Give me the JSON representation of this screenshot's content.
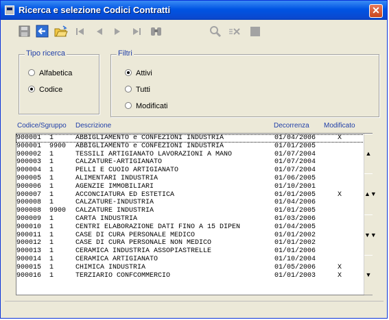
{
  "window": {
    "title": "Ricerca e selezione Codici Contratti",
    "close_label": "✕"
  },
  "toolbar": {
    "icons": [
      "save-icon",
      "back-icon",
      "open-folder-icon",
      "first-record-icon",
      "previous-record-icon",
      "next-record-icon",
      "last-record-icon",
      "binoculars-icon",
      "search-icon",
      "delete-icon",
      "stop-icon"
    ]
  },
  "tipo_ricerca": {
    "label": "Tipo ricerca",
    "options": [
      {
        "label": "Alfabetica",
        "selected": false
      },
      {
        "label": "Codice",
        "selected": true
      }
    ]
  },
  "filtri": {
    "label": "Filtri",
    "options": [
      {
        "label": "Attivi",
        "selected": true
      },
      {
        "label": "Tutti",
        "selected": false
      },
      {
        "label": "Modificati",
        "selected": false
      }
    ]
  },
  "table": {
    "headers": {
      "codice": "Codice/Sgruppo",
      "descrizione": "Descrizione",
      "decorrenza": "Decorrenza",
      "modificato": "Modificato"
    },
    "rows": [
      {
        "codice": "900001",
        "sgruppo": "1",
        "descrizione": "ABBIGLIAMENTO e CONFEZIONI INDUSTRIA",
        "decorrenza": "01/04/2006",
        "modificato": "X",
        "selected": true
      },
      {
        "codice": "900001",
        "sgruppo": "9900",
        "descrizione": "ABBIGLIAMENTO e CONFEZIONI INDUSTRIA",
        "decorrenza": "01/01/2005",
        "modificato": ""
      },
      {
        "codice": "900002",
        "sgruppo": "1",
        "descrizione": "TESSILI ARTIGIANATO LAVORAZIONI A MANO",
        "decorrenza": "01/07/2004",
        "modificato": ""
      },
      {
        "codice": "900003",
        "sgruppo": "1",
        "descrizione": "CALZATURE-ARTIGIANATO",
        "decorrenza": "01/07/2004",
        "modificato": ""
      },
      {
        "codice": "900004",
        "sgruppo": "1",
        "descrizione": "PELLI E CUOIO ARTIGIANATO",
        "decorrenza": "01/07/2004",
        "modificato": ""
      },
      {
        "codice": "900005",
        "sgruppo": "1",
        "descrizione": "ALIMENTARI INDUSTRIA",
        "decorrenza": "01/06/2005",
        "modificato": ""
      },
      {
        "codice": "900006",
        "sgruppo": "1",
        "descrizione": "AGENZIE IMMOBILIARI",
        "decorrenza": "01/10/2001",
        "modificato": ""
      },
      {
        "codice": "900007",
        "sgruppo": "1",
        "descrizione": "ACCONCIATURA ED ESTETICA",
        "decorrenza": "01/01/2005",
        "modificato": "X"
      },
      {
        "codice": "900008",
        "sgruppo": "1",
        "descrizione": "CALZATURE-INDUSTRIA",
        "decorrenza": "01/04/2006",
        "modificato": ""
      },
      {
        "codice": "900008",
        "sgruppo": "9900",
        "descrizione": "CALZATURE INDUSTRIA",
        "decorrenza": "01/01/2005",
        "modificato": ""
      },
      {
        "codice": "900009",
        "sgruppo": "1",
        "descrizione": "CARTA INDUSTRIA",
        "decorrenza": "01/03/2006",
        "modificato": ""
      },
      {
        "codice": "900010",
        "sgruppo": "1",
        "descrizione": "CENTRI ELABORAZIONE DATI FINO A 15 DIPEN",
        "decorrenza": "01/04/2005",
        "modificato": ""
      },
      {
        "codice": "900011",
        "sgruppo": "1",
        "descrizione": "CASE DI CURA PERSONALE MEDICO",
        "decorrenza": "01/01/2002",
        "modificato": ""
      },
      {
        "codice": "900012",
        "sgruppo": "1",
        "descrizione": "CASE DI CURA PERSONALE NON MEDICO",
        "decorrenza": "01/01/2002",
        "modificato": ""
      },
      {
        "codice": "900013",
        "sgruppo": "1",
        "descrizione": "CERAMICA INDUSTRIA ASSOPIASTRELLE",
        "decorrenza": "01/01/2006",
        "modificato": ""
      },
      {
        "codice": "900014",
        "sgruppo": "1",
        "descrizione": "CERAMICA ARTIGIANATO",
        "decorrenza": "01/10/2004",
        "modificato": ""
      },
      {
        "codice": "900015",
        "sgruppo": "1",
        "descrizione": "CHIMICA INDUSTRIA",
        "decorrenza": "01/05/2006",
        "modificato": "X"
      },
      {
        "codice": "900016",
        "sgruppo": "1",
        "descrizione": "TERZIARIO CONFCOMMERCIO",
        "decorrenza": "01/01/2003",
        "modificato": "X"
      }
    ]
  }
}
